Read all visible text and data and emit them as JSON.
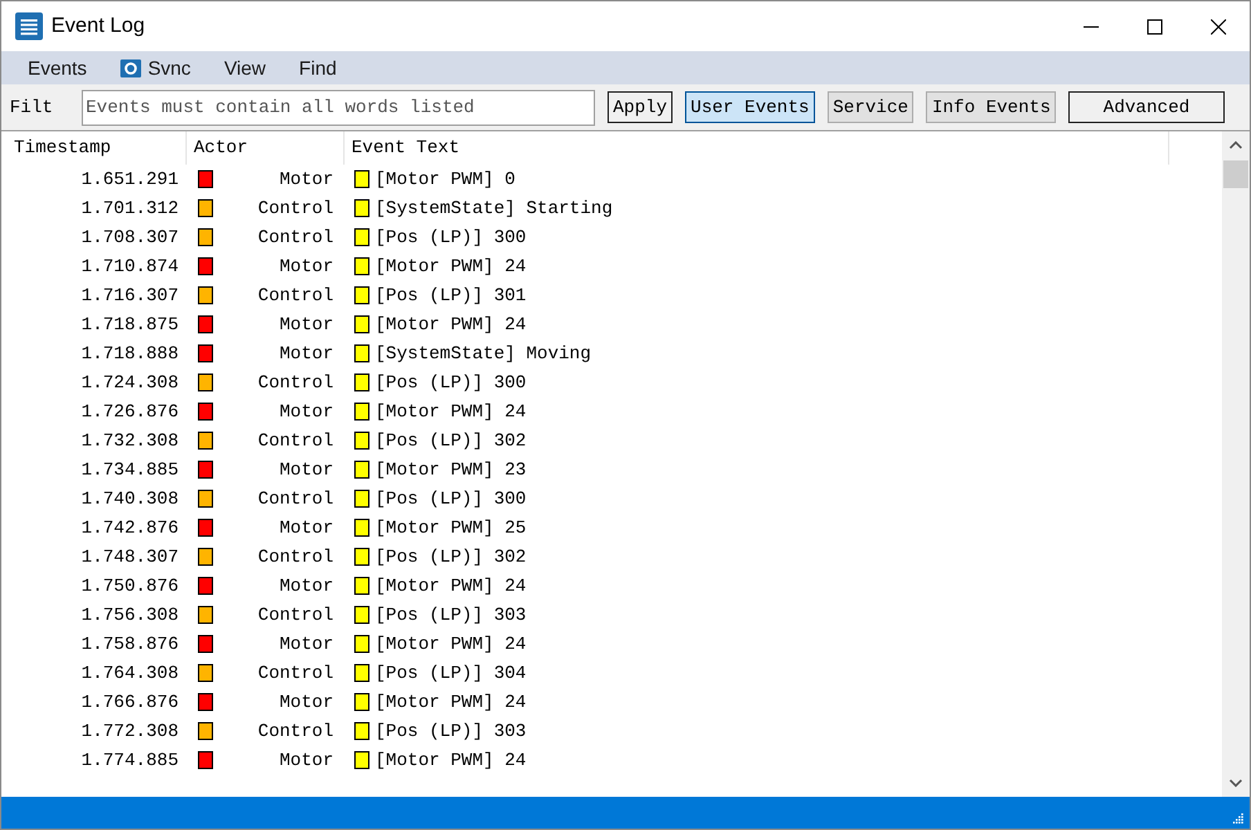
{
  "window": {
    "title": "Event Log"
  },
  "menu": [
    {
      "label": "Events",
      "kind": "text"
    },
    {
      "label": "Svnc",
      "kind": "icon"
    },
    {
      "label": "View",
      "kind": "text"
    },
    {
      "label": "Find",
      "kind": "text"
    }
  ],
  "filter": {
    "label": "Filt",
    "placeholder": "Events must contain all words listed"
  },
  "buttons": [
    {
      "label": "Apply",
      "kind": "plain",
      "selected": false
    },
    {
      "label": "User Events",
      "kind": "toggle",
      "selected": true
    },
    {
      "label": "Service",
      "kind": "toggle",
      "selected": false
    },
    {
      "label": "Info Events",
      "kind": "toggle",
      "selected": false
    },
    {
      "label": "Advanced",
      "kind": "plain",
      "selected": false
    }
  ],
  "table": {
    "columns": [
      "Timestamp",
      "Actor",
      "Event Text"
    ],
    "rows": [
      {
        "timestamp": "1.651.291",
        "actor": {
          "name": "Motor",
          "color": "#ff0000"
        },
        "event": {
          "text": "[Motor PWM] 0",
          "color": "#ffff00"
        }
      },
      {
        "timestamp": "1.701.312",
        "actor": {
          "name": "Control",
          "color": "#ffb400"
        },
        "event": {
          "text": "[SystemState] Starting",
          "color": "#ffff00"
        }
      },
      {
        "timestamp": "1.708.307",
        "actor": {
          "name": "Control",
          "color": "#ffb400"
        },
        "event": {
          "text": "[Pos (LP)] 300",
          "color": "#ffff00"
        }
      },
      {
        "timestamp": "1.710.874",
        "actor": {
          "name": "Motor",
          "color": "#ff0000"
        },
        "event": {
          "text": "[Motor PWM] 24",
          "color": "#ffff00"
        }
      },
      {
        "timestamp": "1.716.307",
        "actor": {
          "name": "Control",
          "color": "#ffb400"
        },
        "event": {
          "text": "[Pos (LP)] 301",
          "color": "#ffff00"
        }
      },
      {
        "timestamp": "1.718.875",
        "actor": {
          "name": "Motor",
          "color": "#ff0000"
        },
        "event": {
          "text": "[Motor PWM] 24",
          "color": "#ffff00"
        }
      },
      {
        "timestamp": "1.718.888",
        "actor": {
          "name": "Motor",
          "color": "#ff0000"
        },
        "event": {
          "text": "[SystemState] Moving",
          "color": "#ffff00"
        }
      },
      {
        "timestamp": "1.724.308",
        "actor": {
          "name": "Control",
          "color": "#ffb400"
        },
        "event": {
          "text": "[Pos (LP)] 300",
          "color": "#ffff00"
        }
      },
      {
        "timestamp": "1.726.876",
        "actor": {
          "name": "Motor",
          "color": "#ff0000"
        },
        "event": {
          "text": "[Motor PWM] 24",
          "color": "#ffff00"
        }
      },
      {
        "timestamp": "1.732.308",
        "actor": {
          "name": "Control",
          "color": "#ffb400"
        },
        "event": {
          "text": "[Pos (LP)] 302",
          "color": "#ffff00"
        }
      },
      {
        "timestamp": "1.734.885",
        "actor": {
          "name": "Motor",
          "color": "#ff0000"
        },
        "event": {
          "text": "[Motor PWM] 23",
          "color": "#ffff00"
        }
      },
      {
        "timestamp": "1.740.308",
        "actor": {
          "name": "Control",
          "color": "#ffb400"
        },
        "event": {
          "text": "[Pos (LP)] 300",
          "color": "#ffff00"
        }
      },
      {
        "timestamp": "1.742.876",
        "actor": {
          "name": "Motor",
          "color": "#ff0000"
        },
        "event": {
          "text": "[Motor PWM] 25",
          "color": "#ffff00"
        }
      },
      {
        "timestamp": "1.748.307",
        "actor": {
          "name": "Control",
          "color": "#ffb400"
        },
        "event": {
          "text": "[Pos (LP)] 302",
          "color": "#ffff00"
        }
      },
      {
        "timestamp": "1.750.876",
        "actor": {
          "name": "Motor",
          "color": "#ff0000"
        },
        "event": {
          "text": "[Motor PWM] 24",
          "color": "#ffff00"
        }
      },
      {
        "timestamp": "1.756.308",
        "actor": {
          "name": "Control",
          "color": "#ffb400"
        },
        "event": {
          "text": "[Pos (LP)] 303",
          "color": "#ffff00"
        }
      },
      {
        "timestamp": "1.758.876",
        "actor": {
          "name": "Motor",
          "color": "#ff0000"
        },
        "event": {
          "text": "[Motor PWM] 24",
          "color": "#ffff00"
        }
      },
      {
        "timestamp": "1.764.308",
        "actor": {
          "name": "Control",
          "color": "#ffb400"
        },
        "event": {
          "text": "[Pos (LP)] 304",
          "color": "#ffff00"
        }
      },
      {
        "timestamp": "1.766.876",
        "actor": {
          "name": "Motor",
          "color": "#ff0000"
        },
        "event": {
          "text": "[Motor PWM] 24",
          "color": "#ffff00"
        }
      },
      {
        "timestamp": "1.772.308",
        "actor": {
          "name": "Control",
          "color": "#ffb400"
        },
        "event": {
          "text": "[Pos (LP)] 303",
          "color": "#ffff00"
        }
      },
      {
        "timestamp": "1.774.885",
        "actor": {
          "name": "Motor",
          "color": "#ff0000"
        },
        "event": {
          "text": "[Motor PWM] 24",
          "color": "#ffff00"
        }
      }
    ]
  }
}
